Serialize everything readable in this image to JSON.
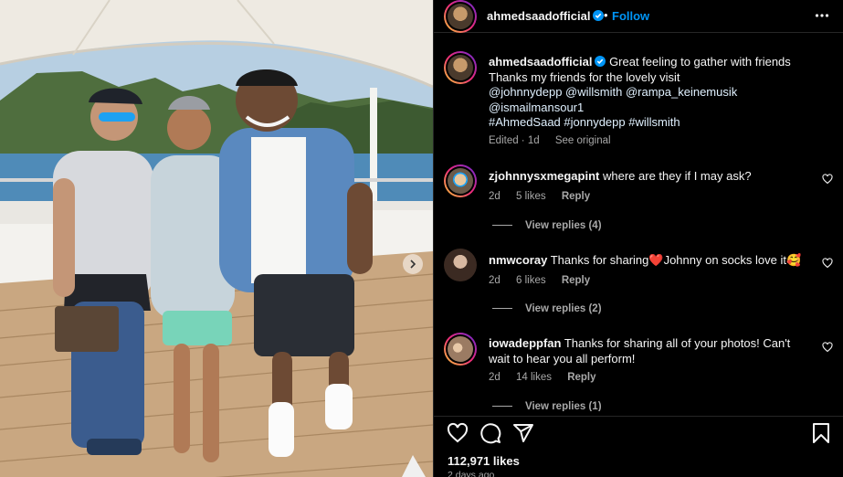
{
  "post": {
    "username": "ahmedsaadofficial",
    "follow_label": "Follow",
    "separator": "•",
    "caption_lines": [
      "Great feeling to gather with friends",
      "Thanks my friends for the lovely visit",
      "@johnnydepp @willsmith @rampa_keinemusik",
      "@ismailmansour1",
      "#AhmedSaad #jonnydepp #willsmith"
    ],
    "caption_meta": {
      "edited": "Edited · 1d",
      "see_original": "See original"
    }
  },
  "comments": [
    {
      "username": "zjohnnysxmegapint",
      "text": "where are they if I may ask?",
      "time": "2d",
      "likes": "5 likes",
      "reply_label": "Reply",
      "view_replies": "View replies (4)"
    },
    {
      "username": "nmwcoray",
      "text_before": "Thanks for sharing",
      "emoji1": "❤️",
      "text_after": "Johnny on socks love it",
      "emoji2": "🥰",
      "time": "2d",
      "likes": "6 likes",
      "reply_label": "Reply",
      "view_replies": "View replies (2)"
    },
    {
      "username": "iowadeppfan",
      "text": "Thanks for sharing all of your photos! Can't wait to hear you all perform!",
      "time": "2d",
      "likes": "14 likes",
      "reply_label": "Reply",
      "view_replies": "View replies (1)"
    }
  ],
  "footer": {
    "likes": "112,971 likes",
    "time_ago": "2 days ago"
  },
  "colors": {
    "accent": "#0095f6",
    "secondary_text": "#a8a8a8",
    "background": "#000000",
    "divider": "#262626"
  },
  "icons": [
    "verified-badge-icon",
    "more-options-icon",
    "heart-icon",
    "comment-icon",
    "share-icon",
    "bookmark-icon",
    "chevron-right-icon"
  ]
}
